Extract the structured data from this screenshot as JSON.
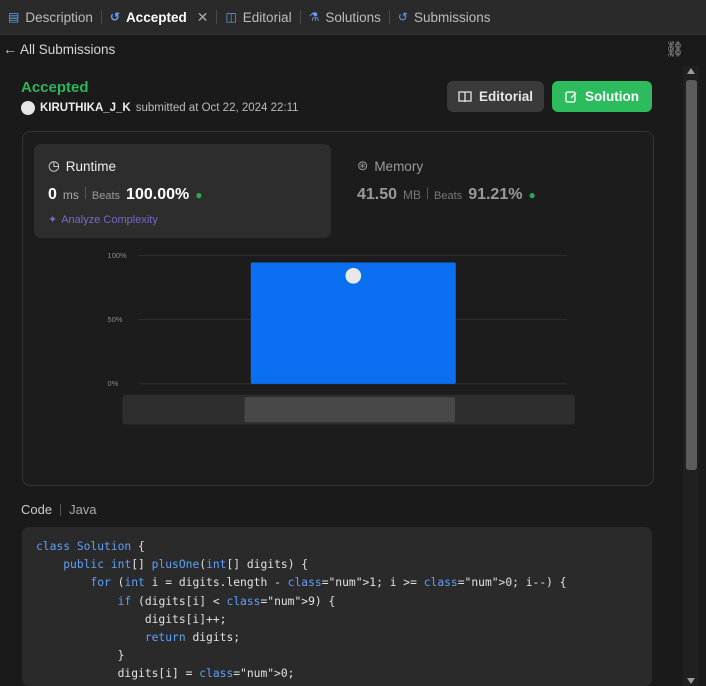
{
  "tabs": [
    {
      "label": "Description",
      "icon": "description-icon"
    },
    {
      "label": "Accepted",
      "icon": "history-icon",
      "active": true
    },
    {
      "label": "Editorial",
      "icon": "book-icon"
    },
    {
      "label": "Solutions",
      "icon": "flask-icon"
    },
    {
      "label": "Submissions",
      "icon": "history-icon"
    }
  ],
  "subbar": {
    "back_label": "All Submissions"
  },
  "submission": {
    "status": "Accepted",
    "user": "KIRUTHIKA_J_K",
    "submitted_text": "submitted at Oct 22, 2024 22:11"
  },
  "actions": {
    "editorial_label": "Editorial",
    "solution_label": "Solution"
  },
  "runtime": {
    "title": "Runtime",
    "value": "0",
    "unit": "ms",
    "beats_label": "Beats",
    "beats_value": "100.00%",
    "analyze_label": "Analyze Complexity"
  },
  "memory": {
    "title": "Memory",
    "value": "41.50",
    "unit": "MB",
    "beats_label": "Beats",
    "beats_value": "91.21%"
  },
  "chart_data": {
    "type": "bar",
    "yticks": [
      "100%",
      "50%",
      "0%"
    ],
    "ylim": [
      0,
      100
    ],
    "bars": [
      {
        "value": 100,
        "marker": "avatar"
      }
    ],
    "range_selector": {
      "start": 0.27,
      "end": 0.735
    }
  },
  "code": {
    "label": "Code",
    "language": "Java",
    "lines": [
      "class Solution {",
      "    public int[] plusOne(int[] digits) {",
      "        for (int i = digits.length - 1; i >= 0; i--) {",
      "            if (digits[i] < 9) {",
      "                digits[i]++;",
      "                return digits;",
      "            }",
      "            digits[i] = 0;"
    ]
  },
  "colors": {
    "accent_green": "#2cbb5d",
    "bar_blue": "#0a6ff0",
    "bg": "#1a1a1a"
  }
}
